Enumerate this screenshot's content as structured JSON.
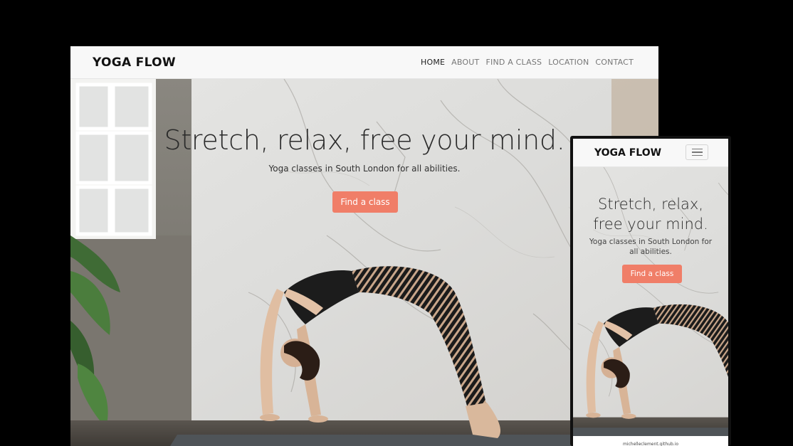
{
  "colors": {
    "accent": "#f07e68",
    "nav_background": "#f8f8f8",
    "background": "#000000"
  },
  "desktop": {
    "brand": "YOGA FLOW",
    "nav": [
      {
        "label": "HOME",
        "active": true
      },
      {
        "label": "ABOUT",
        "active": false
      },
      {
        "label": "FIND A CLASS",
        "active": false
      },
      {
        "label": "LOCATION",
        "active": false
      },
      {
        "label": "CONTACT",
        "active": false
      }
    ],
    "hero": {
      "headline": "Stretch, relax, free your mind.",
      "subtitle": "Yoga classes in South London for all abilities.",
      "button": "Find a class",
      "image": "yoga-backbend-photo"
    }
  },
  "mobile": {
    "brand": "YOGA FLOW",
    "menu_icon": "hamburger-icon",
    "hero": {
      "headline_line1": "Stretch, relax,",
      "headline_line2": "free your mind.",
      "subtitle": "Yoga classes in South London for all abilities.",
      "button": "Find a class",
      "image": "yoga-backbend-photo"
    },
    "footer_url": "michelleclement.github.io"
  }
}
